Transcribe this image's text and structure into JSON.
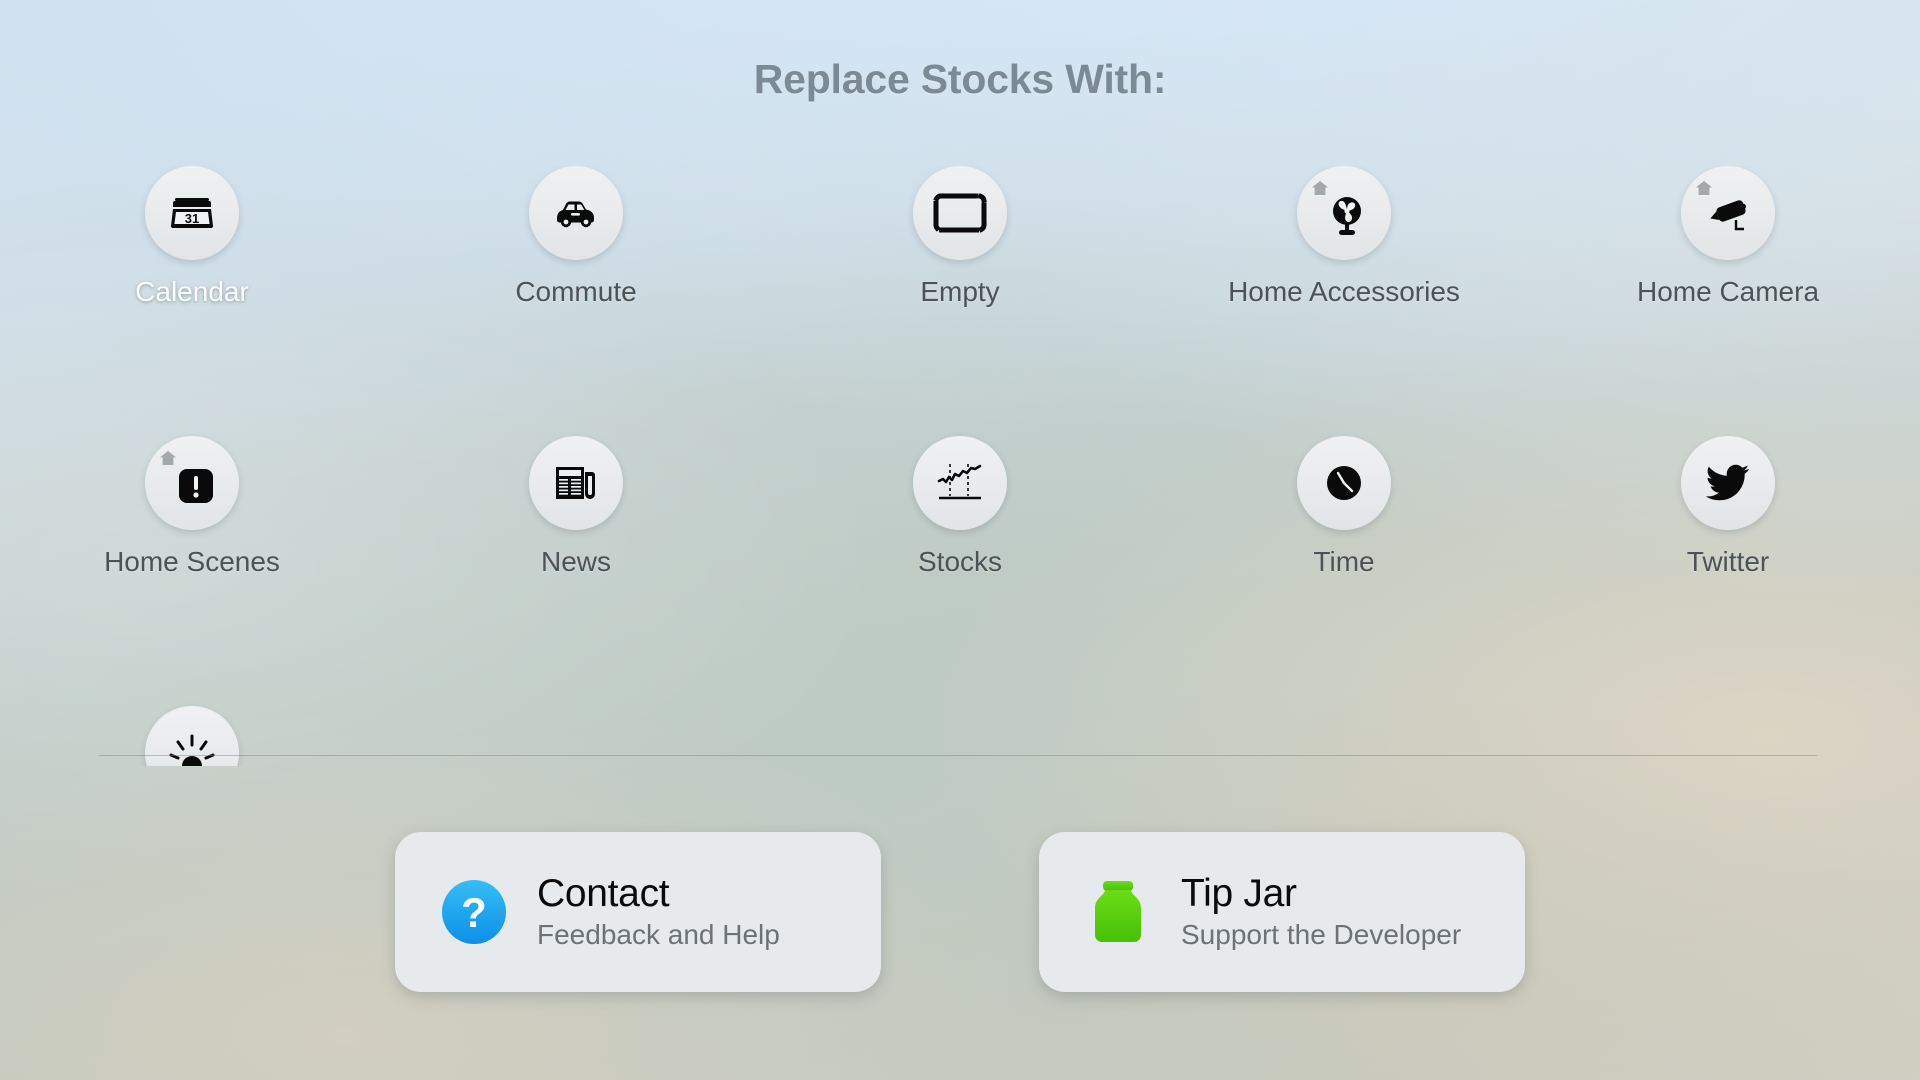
{
  "page": {
    "title": "Replace Stocks With:"
  },
  "grid": {
    "rows": [
      [
        {
          "label": "Calendar",
          "icon": "calendar-icon",
          "selected": true,
          "badge": "none"
        },
        {
          "label": "Commute",
          "icon": "car-icon",
          "selected": false,
          "badge": "none"
        },
        {
          "label": "Empty",
          "icon": "dashed-rectangle-icon",
          "selected": false,
          "badge": "none"
        },
        {
          "label": "Home Accessories",
          "icon": "fan-icon",
          "selected": false,
          "badge": "house"
        },
        {
          "label": "Home Camera",
          "icon": "security-camera-icon",
          "selected": false,
          "badge": "house"
        }
      ],
      [
        {
          "label": "Home Scenes",
          "icon": "exclamation-square-icon",
          "selected": false,
          "badge": "house"
        },
        {
          "label": "News",
          "icon": "newspaper-icon",
          "selected": false,
          "badge": "none"
        },
        {
          "label": "Stocks",
          "icon": "stock-chart-icon",
          "selected": false,
          "badge": "none"
        },
        {
          "label": "Time",
          "icon": "clock-icon",
          "selected": false,
          "badge": "none"
        },
        {
          "label": "Twitter",
          "icon": "twitter-bird-icon",
          "selected": false,
          "badge": "none"
        }
      ],
      [
        {
          "label": "",
          "icon": "sunrise-icon",
          "selected": false,
          "badge": "none"
        }
      ]
    ]
  },
  "cards": [
    {
      "title": "Contact",
      "subtitle": "Feedback and Help",
      "icon": "question-mark-circle-icon",
      "icon_color": "#1fa8f0",
      "glyph": "?"
    },
    {
      "title": "Tip Jar",
      "subtitle": "Support the Developer",
      "icon": "jar-icon",
      "icon_color": "#5bcc10",
      "glyph": ""
    }
  ],
  "colors": {
    "title_text": "#7c8a95",
    "label_text": "#4c5255",
    "label_selected": "#ffffff",
    "card_background": "#e7eaec",
    "icon_circle": "#e8ebec",
    "accent_blue": "#1fa8f0",
    "accent_green": "#5bcc10",
    "divider": "#7a8282"
  }
}
